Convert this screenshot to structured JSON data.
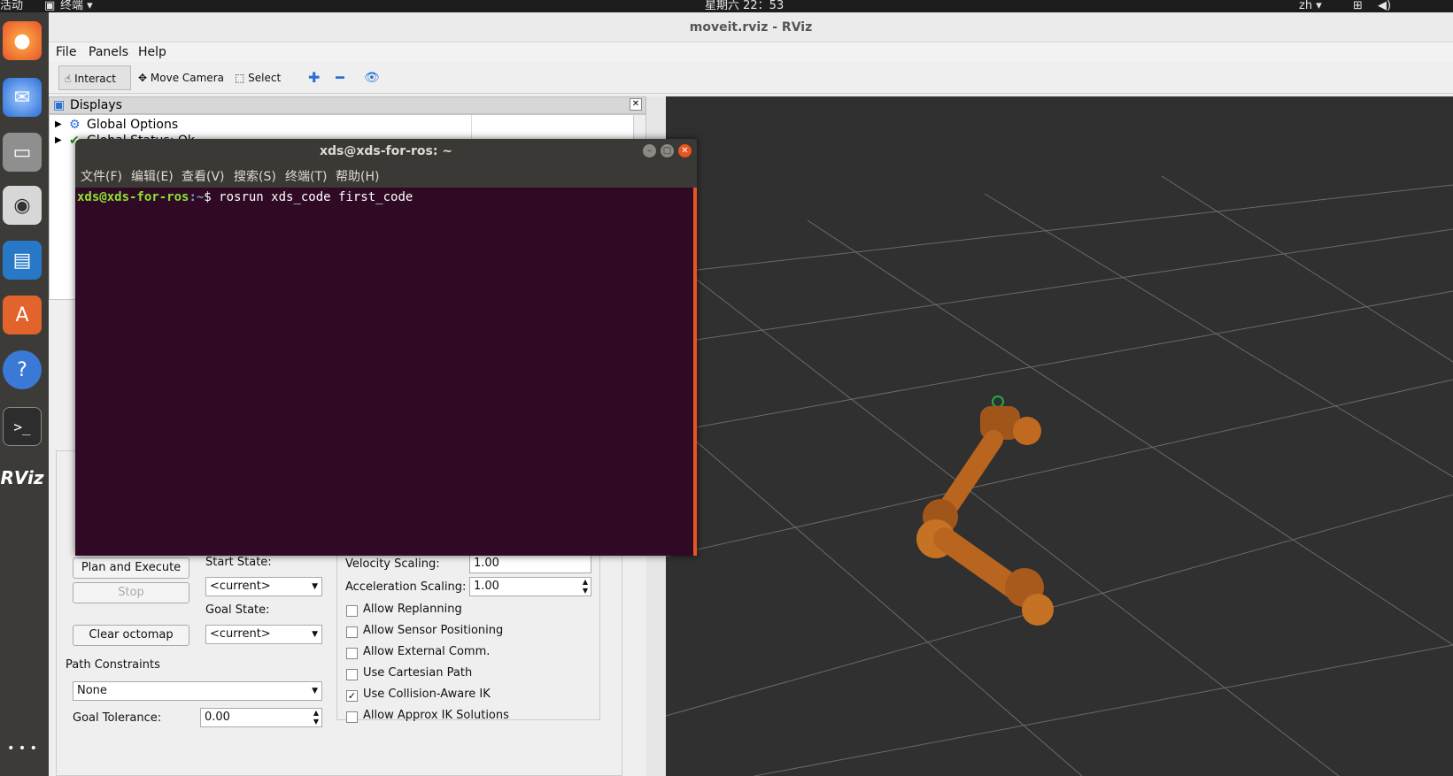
{
  "topbar": {
    "activities": "活动",
    "app_menu": "终端 ▾",
    "clock": "星期六 22：53",
    "lang": "zh ▾"
  },
  "window": {
    "title": "moveit.rviz - RViz"
  },
  "menu": {
    "file": "File",
    "panels": "Panels",
    "help": "Help"
  },
  "toolbar": {
    "interact": "Interact",
    "move_camera": "Move Camera",
    "select": "Select"
  },
  "displays": {
    "title": "Displays",
    "items": [
      {
        "label": "Global Options"
      },
      {
        "label": "Global Status: Ok"
      }
    ]
  },
  "planning": {
    "plan_execute": "Plan and Execute",
    "stop": "Stop",
    "clear_octomap": "Clear octomap",
    "start_state_label": "Start State:",
    "start_state": "<current>",
    "goal_state_label": "Goal State:",
    "goal_state": "<current>",
    "path_constraints_label": "Path Constraints",
    "path_constraints": "None",
    "goal_tolerance_label": "Goal Tolerance:",
    "goal_tolerance": "0.00",
    "velocity_label": "Velocity Scaling:",
    "velocity": "1.00",
    "accel_label": "Acceleration Scaling:",
    "accel": "1.00",
    "options": [
      {
        "label": "Allow Replanning",
        "checked": false
      },
      {
        "label": "Allow Sensor Positioning",
        "checked": false
      },
      {
        "label": "Allow External Comm.",
        "checked": false
      },
      {
        "label": "Use Cartesian Path",
        "checked": false
      },
      {
        "label": "Use Collision-Aware IK",
        "checked": true
      },
      {
        "label": "Allow Approx IK Solutions",
        "checked": false
      }
    ]
  },
  "terminal": {
    "title": "xds@xds-for-ros: ~",
    "menu": [
      "文件(F)",
      "编辑(E)",
      "查看(V)",
      "搜索(S)",
      "终端(T)",
      "帮助(H)"
    ],
    "prompt_user": "xds@xds-for-ros",
    "prompt_path": ":~",
    "prompt_symbol": "$ ",
    "command": "rosrun xds_code first_code"
  },
  "dock": {
    "rviz_label": "RViz"
  }
}
